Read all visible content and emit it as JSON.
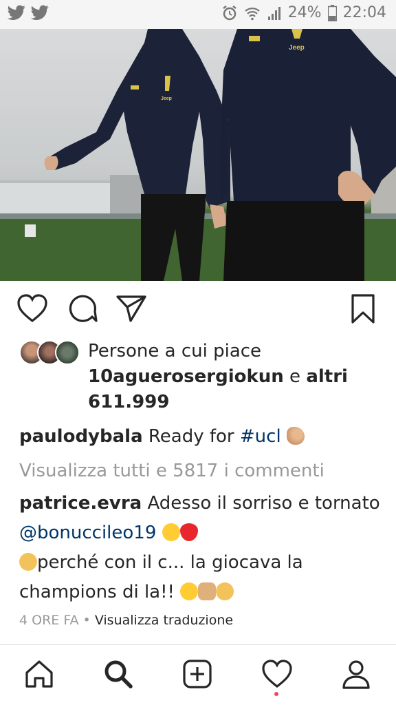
{
  "status_bar": {
    "left_icons": [
      "twitter-icon",
      "twitter-icon"
    ],
    "battery": "24%",
    "time": "22:04",
    "icons": [
      "alarm-icon",
      "wifi-icon",
      "signal-icon",
      "battery-icon"
    ]
  },
  "post": {
    "photo_jersey_text": "Jeep",
    "actions": [
      "heart-icon",
      "comment-icon",
      "share-icon",
      "bookmark-icon"
    ],
    "likes": {
      "prefix": "Persone a cui piace",
      "user": "10aguerosergiokun",
      "middle": " e ",
      "others": "altri 611.999"
    },
    "caption": {
      "user": "paulodybala",
      "text": " Ready for ",
      "hashtag": "#ucl"
    },
    "view_comments": "Visualizza tutti e 5817 i commenti",
    "comment": {
      "user": "patrice.evra",
      "text1": " Adesso il sorriso e tornato ",
      "mention": "@bonuccileo19",
      "text2": "perché con il c... la giocava la champions di la!!"
    },
    "time_ago": "4 ORE FA",
    "separator": " • ",
    "translate": "Visualizza traduzione"
  },
  "colors": {
    "link": "#003569",
    "muted": "#999999",
    "notification": "#ed4956"
  },
  "bottom_nav": [
    "home-icon",
    "search-icon",
    "add-icon",
    "activity-icon",
    "profile-icon"
  ]
}
